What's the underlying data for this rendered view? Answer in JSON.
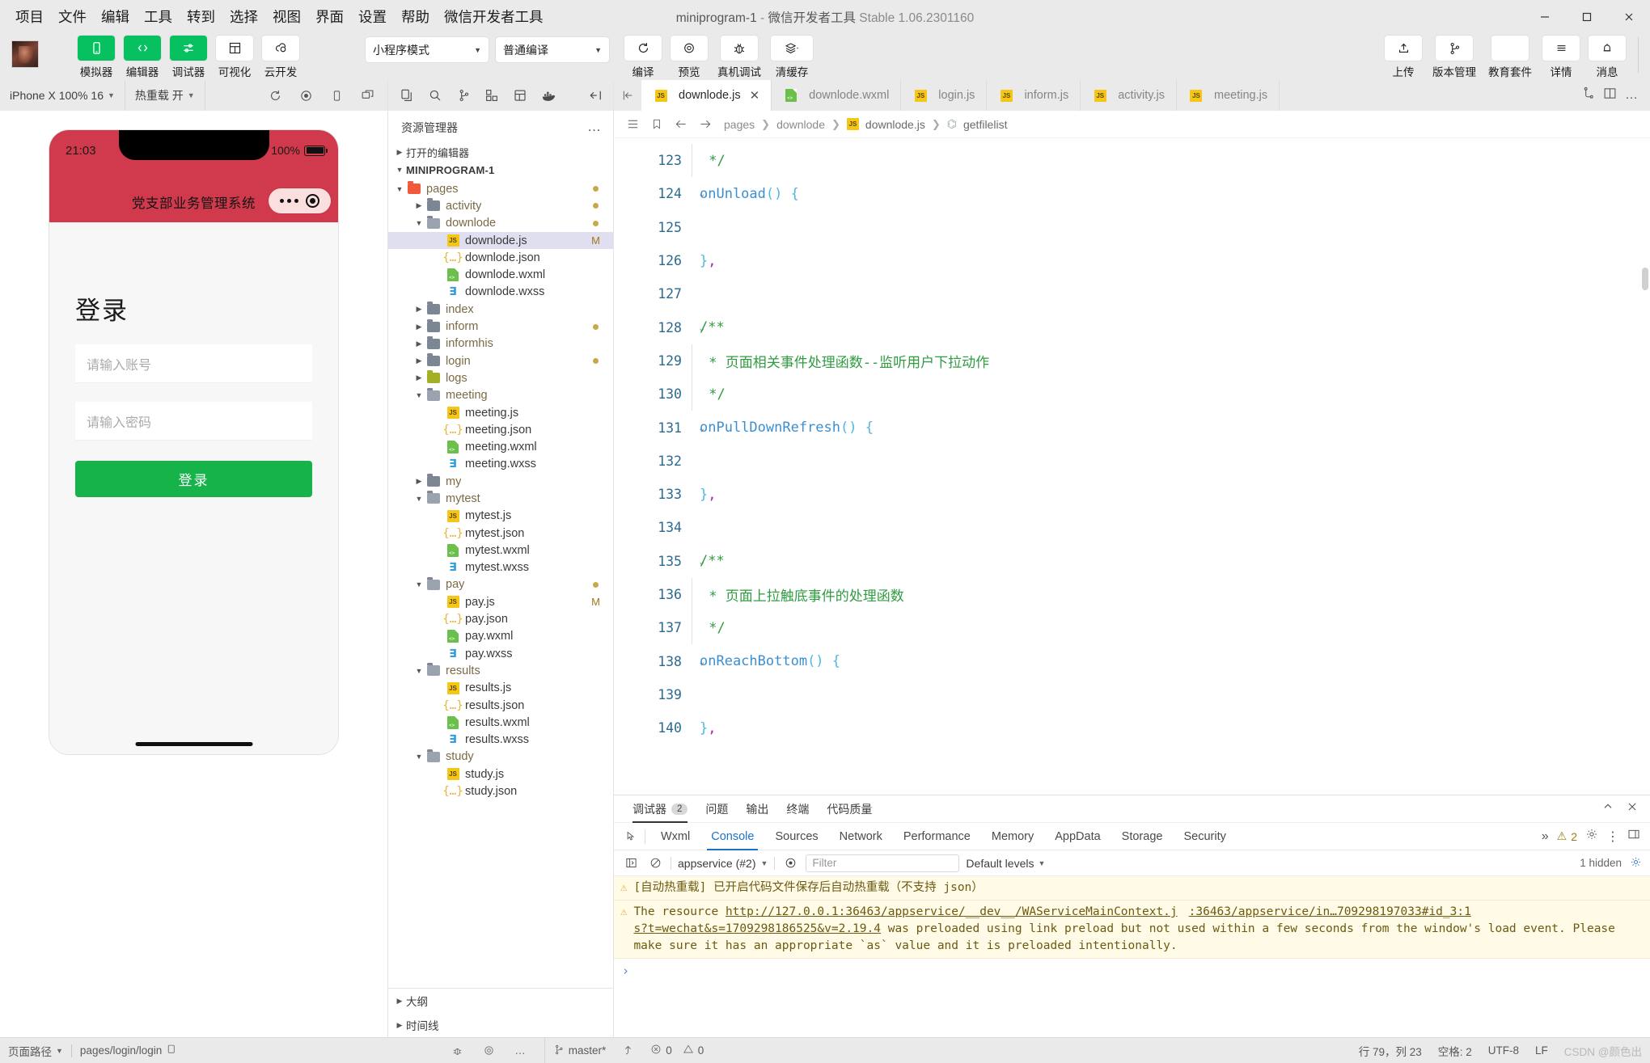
{
  "window": {
    "title_main": "miniprogram-1",
    "title_dash": " - ",
    "title_app": "微信开发者工具",
    "title_version": "Stable 1.06.2301160"
  },
  "menu": [
    "项目",
    "文件",
    "编辑",
    "工具",
    "转到",
    "选择",
    "视图",
    "界面",
    "设置",
    "帮助",
    "微信开发者工具"
  ],
  "toolbar": {
    "left_buttons": [
      {
        "label": "模拟器",
        "icon": "phone-icon",
        "style": "green"
      },
      {
        "label": "编辑器",
        "icon": "code-icon",
        "style": "green"
      },
      {
        "label": "调试器",
        "icon": "debug-sliders-icon",
        "style": "green"
      },
      {
        "label": "可视化",
        "icon": "layout-icon",
        "style": "white"
      },
      {
        "label": "云开发",
        "icon": "cloud-icon",
        "style": "white"
      }
    ],
    "mode_select": "小程序模式",
    "compile_select": "普通编译",
    "mid_buttons": [
      {
        "label": "编译",
        "icon": "refresh-icon"
      },
      {
        "label": "预览",
        "icon": "eye-icon"
      },
      {
        "label": "真机调试",
        "icon": "bug-icon"
      },
      {
        "label": "清缓存",
        "icon": "layers-icon"
      }
    ],
    "right_buttons": [
      {
        "label": "上传",
        "icon": "upload-icon"
      },
      {
        "label": "版本管理",
        "icon": "branch-icon"
      },
      {
        "label": "教育套件",
        "icon": "blank-icon"
      },
      {
        "label": "详情",
        "icon": "hamburger-icon"
      },
      {
        "label": "消息",
        "icon": "bell-icon"
      }
    ]
  },
  "simulator": {
    "device_select": "iPhone X 100% 16",
    "hotreload_select": "热重载 开",
    "status_time": "21:03",
    "status_battery": "100%",
    "nav_title": "党支部业务管理系统",
    "login_heading": "登录",
    "account_placeholder": "请输入账号",
    "password_placeholder": "请输入密码",
    "login_button": "登录"
  },
  "explorer": {
    "header": "资源管理器",
    "open_editors": "打开的编辑器",
    "project_root": "MINIPROGRAM-1",
    "footer": [
      "大纲",
      "时间线"
    ],
    "tree": [
      {
        "label": "pages",
        "depth": 1,
        "kind": "folder-pages",
        "twisty": "down",
        "mark": "dot"
      },
      {
        "label": "activity",
        "depth": 2,
        "kind": "folder",
        "twisty": "right",
        "mark": "dot"
      },
      {
        "label": "downlode",
        "depth": 2,
        "kind": "folder-open",
        "twisty": "down",
        "mark": "dot"
      },
      {
        "label": "downlode.js",
        "depth": 3,
        "kind": "js",
        "selected": true,
        "mark": "M"
      },
      {
        "label": "downlode.json",
        "depth": 3,
        "kind": "json"
      },
      {
        "label": "downlode.wxml",
        "depth": 3,
        "kind": "wxml"
      },
      {
        "label": "downlode.wxss",
        "depth": 3,
        "kind": "wxss"
      },
      {
        "label": "index",
        "depth": 2,
        "kind": "folder",
        "twisty": "right"
      },
      {
        "label": "inform",
        "depth": 2,
        "kind": "folder",
        "twisty": "right",
        "mark": "dot"
      },
      {
        "label": "informhis",
        "depth": 2,
        "kind": "folder",
        "twisty": "right"
      },
      {
        "label": "login",
        "depth": 2,
        "kind": "folder",
        "twisty": "right",
        "mark": "dot"
      },
      {
        "label": "logs",
        "depth": 2,
        "kind": "folder-logs",
        "twisty": "right"
      },
      {
        "label": "meeting",
        "depth": 2,
        "kind": "folder-open",
        "twisty": "down"
      },
      {
        "label": "meeting.js",
        "depth": 3,
        "kind": "js"
      },
      {
        "label": "meeting.json",
        "depth": 3,
        "kind": "json"
      },
      {
        "label": "meeting.wxml",
        "depth": 3,
        "kind": "wxml"
      },
      {
        "label": "meeting.wxss",
        "depth": 3,
        "kind": "wxss"
      },
      {
        "label": "my",
        "depth": 2,
        "kind": "folder",
        "twisty": "right"
      },
      {
        "label": "mytest",
        "depth": 2,
        "kind": "folder-open",
        "twisty": "down"
      },
      {
        "label": "mytest.js",
        "depth": 3,
        "kind": "js"
      },
      {
        "label": "mytest.json",
        "depth": 3,
        "kind": "json"
      },
      {
        "label": "mytest.wxml",
        "depth": 3,
        "kind": "wxml"
      },
      {
        "label": "mytest.wxss",
        "depth": 3,
        "kind": "wxss"
      },
      {
        "label": "pay",
        "depth": 2,
        "kind": "folder-open",
        "twisty": "down",
        "mark": "dot"
      },
      {
        "label": "pay.js",
        "depth": 3,
        "kind": "js",
        "mark": "M"
      },
      {
        "label": "pay.json",
        "depth": 3,
        "kind": "json"
      },
      {
        "label": "pay.wxml",
        "depth": 3,
        "kind": "wxml"
      },
      {
        "label": "pay.wxss",
        "depth": 3,
        "kind": "wxss"
      },
      {
        "label": "results",
        "depth": 2,
        "kind": "folder-open",
        "twisty": "down"
      },
      {
        "label": "results.js",
        "depth": 3,
        "kind": "js"
      },
      {
        "label": "results.json",
        "depth": 3,
        "kind": "json"
      },
      {
        "label": "results.wxml",
        "depth": 3,
        "kind": "wxml"
      },
      {
        "label": "results.wxss",
        "depth": 3,
        "kind": "wxss"
      },
      {
        "label": "study",
        "depth": 2,
        "kind": "folder-open",
        "twisty": "down"
      },
      {
        "label": "study.js",
        "depth": 3,
        "kind": "js"
      },
      {
        "label": "study.json",
        "depth": 3,
        "kind": "json"
      }
    ]
  },
  "editor": {
    "tabs": [
      {
        "label": "downlode.js",
        "kind": "js",
        "active": true,
        "closable": true
      },
      {
        "label": "downlode.wxml",
        "kind": "wxml",
        "active": false
      },
      {
        "label": "login.js",
        "kind": "js",
        "active": false
      },
      {
        "label": "inform.js",
        "kind": "js",
        "active": false
      },
      {
        "label": "activity.js",
        "kind": "js",
        "active": false
      },
      {
        "label": "meeting.js",
        "kind": "js",
        "active": false
      }
    ],
    "breadcrumb": [
      "pages",
      "downlode",
      "downlode.js",
      "getfilelist"
    ],
    "lines": [
      {
        "n": 123,
        "fold": false,
        "indent": true,
        "tokens": [
          {
            "t": " */",
            "c": "c-com"
          }
        ]
      },
      {
        "n": 124,
        "fold": true,
        "indent": false,
        "tokens": [
          {
            "t": "onUnload",
            "c": "c-fn"
          },
          {
            "t": "()",
            "c": "c-par"
          },
          {
            "t": " {",
            "c": "c-brc"
          }
        ]
      },
      {
        "n": 125,
        "fold": false,
        "indent": false,
        "tokens": []
      },
      {
        "n": 126,
        "fold": false,
        "indent": false,
        "tokens": [
          {
            "t": "}",
            "c": "c-brc"
          },
          {
            "t": ",",
            "c": "c-pun"
          }
        ]
      },
      {
        "n": 127,
        "fold": false,
        "indent": false,
        "tokens": []
      },
      {
        "n": 128,
        "fold": true,
        "indent": false,
        "tokens": [
          {
            "t": "/**",
            "c": "c-com"
          }
        ]
      },
      {
        "n": 129,
        "fold": false,
        "indent": true,
        "tokens": [
          {
            "t": " * 页面相关事件处理函数--监听用户下拉动作",
            "c": "c-com"
          }
        ]
      },
      {
        "n": 130,
        "fold": false,
        "indent": true,
        "tokens": [
          {
            "t": " */",
            "c": "c-com"
          }
        ]
      },
      {
        "n": 131,
        "fold": true,
        "indent": false,
        "tokens": [
          {
            "t": "onPullDownRefresh",
            "c": "c-fn"
          },
          {
            "t": "()",
            "c": "c-par"
          },
          {
            "t": " {",
            "c": "c-brc"
          }
        ]
      },
      {
        "n": 132,
        "fold": false,
        "indent": false,
        "tokens": []
      },
      {
        "n": 133,
        "fold": false,
        "indent": false,
        "tokens": [
          {
            "t": "}",
            "c": "c-brc"
          },
          {
            "t": ",",
            "c": "c-pun"
          }
        ]
      },
      {
        "n": 134,
        "fold": false,
        "indent": false,
        "tokens": []
      },
      {
        "n": 135,
        "fold": true,
        "indent": false,
        "tokens": [
          {
            "t": "/**",
            "c": "c-com"
          }
        ]
      },
      {
        "n": 136,
        "fold": false,
        "indent": true,
        "tokens": [
          {
            "t": " * 页面上拉触底事件的处理函数",
            "c": "c-com"
          }
        ]
      },
      {
        "n": 137,
        "fold": false,
        "indent": true,
        "tokens": [
          {
            "t": " */",
            "c": "c-com"
          }
        ]
      },
      {
        "n": 138,
        "fold": true,
        "indent": false,
        "tokens": [
          {
            "t": "onReachBottom",
            "c": "c-fn"
          },
          {
            "t": "()",
            "c": "c-par"
          },
          {
            "t": " {",
            "c": "c-brc"
          }
        ]
      },
      {
        "n": 139,
        "fold": false,
        "indent": false,
        "tokens": []
      },
      {
        "n": 140,
        "fold": false,
        "indent": false,
        "tokens": [
          {
            "t": "}",
            "c": "c-brc"
          },
          {
            "t": ",",
            "c": "c-pun"
          }
        ]
      }
    ]
  },
  "debugger": {
    "panel_tabs": [
      {
        "label": "调试器",
        "count": "2",
        "active": true
      },
      {
        "label": "问题"
      },
      {
        "label": "输出"
      },
      {
        "label": "终端"
      },
      {
        "label": "代码质量"
      }
    ],
    "warn_count": "2",
    "devtools_tabs": [
      "Wxml",
      "Console",
      "Sources",
      "Network",
      "Performance",
      "Memory",
      "AppData",
      "Storage",
      "Security"
    ],
    "devtools_active": "Console",
    "devtools_overflow": "»",
    "context_select": "appservice (#2)",
    "filter_placeholder": "Filter",
    "levels_label": "Default levels",
    "hidden_label": "1 hidden",
    "messages": [
      {
        "icon": "warning-icon",
        "text": "[自动热重载] 已开启代码文件保存后自动热重载（不支持 json）"
      },
      {
        "icon": "warning-icon",
        "prefix": "The resource ",
        "link1": "http://127.0.0.1:36463/appservice/__dev__/WAServiceMainContext.j",
        "link_right": ":36463/appservice/in…709298197033#id_3:1",
        "link2": "s?t=wechat&s=1709298186525&v=2.19.4",
        "suffix": " was preloaded using link preload but not used within a few seconds from the window's load event. Please make sure it has an appropriate `as` value and it is preloaded intentionally."
      }
    ],
    "prompt": "›"
  },
  "statusbar": {
    "page_path_label": "页面路径",
    "page_path_value": "pages/login/login",
    "branch": "master*",
    "errors": "0",
    "warnings": "0",
    "cursor": "行 79，列 23",
    "spaces": "空格: 2",
    "encoding": "UTF-8",
    "eol": "LF",
    "watermark": "CSDN @颜色出"
  },
  "colors": {
    "accent_green": "#07c160",
    "nav_red": "#d13a4c",
    "login_green": "#16b24a",
    "warn_bg": "#fffbe6",
    "js_yellow": "#f5c518"
  }
}
